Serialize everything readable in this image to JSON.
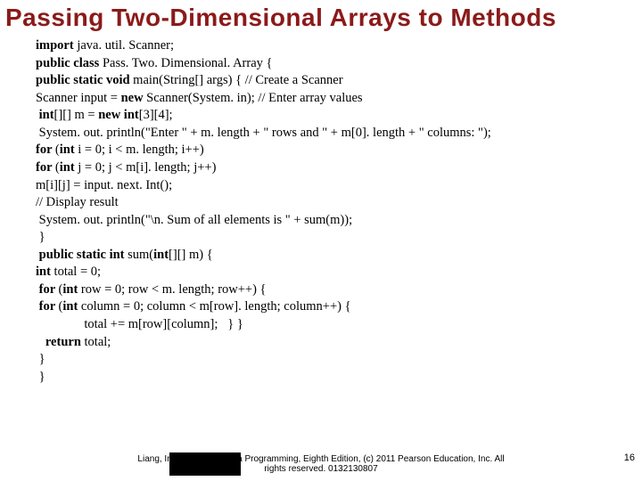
{
  "title": "Passing Two-Dimensional Arrays to Methods",
  "code": {
    "l1a": "import ",
    "l1b": "java. util. Scanner;",
    "l2a": "public class ",
    "l2b": "Pass. Two. Dimensional. Array {",
    "l3a": "public static void ",
    "l3b": "main(String[] args) { // Create a Scanner",
    "l4a": "Scanner input = ",
    "l4b": "new ",
    "l4c": "Scanner(System. in); // Enter array values",
    "l5a": " int",
    "l5b": "[][] m = ",
    "l5c": "new int",
    "l5d": "[3][4];",
    "l6": " System. out. println(\"Enter \" + m. length + \" rows and \" + m[0]. length + \" columns: \");",
    "l7a": "for ",
    "l7b": "(",
    "l7c": "int ",
    "l7d": "i = 0; i < m. length; i++)",
    "l8a": "for ",
    "l8b": "(",
    "l8c": "int ",
    "l8d": "j = 0; j < m[i]. length; j++)",
    "l9": "m[i][j] = input. next. Int();",
    "l10": "// Display result",
    "l11": " System. out. println(\"\\n. Sum of all elements is \" + sum(m));",
    "l12": " }",
    "l13a": " public static int ",
    "l13b": "sum(",
    "l13c": "int",
    "l13d": "[][] m) {",
    "l14a": "int ",
    "l14b": "total = 0;",
    "l15a": " for ",
    "l15b": "(",
    "l15c": "int ",
    "l15d": "row = 0; row < m. length; row++) {",
    "l16a": " for ",
    "l16b": "(",
    "l16c": "int ",
    "l16d": "column = 0; column < m[row]. length; column++) {",
    "l17": "               total += m[row][column];   } }",
    "l18a": "   return ",
    "l18b": "total;",
    "l19": " }",
    "l20": " }"
  },
  "footer": {
    "line1": "Liang, Introduction to Java Programming, Eighth Edition, (c) 2011 Pearson Education, Inc. All",
    "line2": "rights reserved. 0132130807"
  },
  "page": "16"
}
